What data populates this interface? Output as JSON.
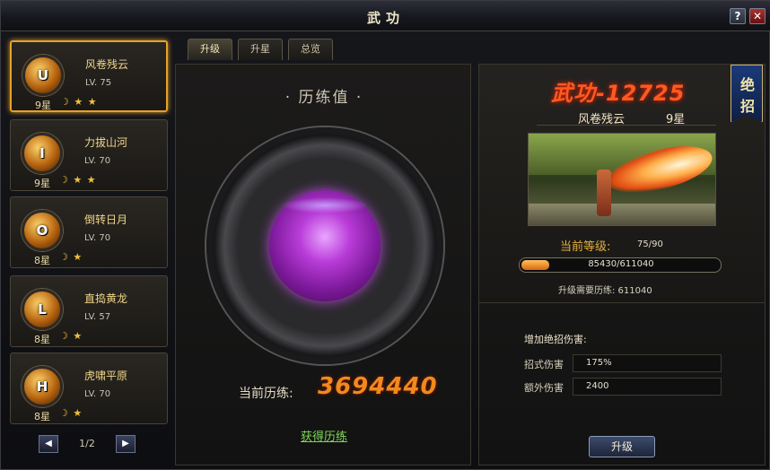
{
  "window": {
    "title": "武功",
    "help_icon": "?",
    "close_icon": "✕"
  },
  "tabs": [
    {
      "label": "升级",
      "active": true
    },
    {
      "label": "升星",
      "active": false
    },
    {
      "label": "总览",
      "active": false
    }
  ],
  "skills": [
    {
      "key": "U",
      "name": "风卷残云",
      "level": "LV. 75",
      "stars": "9星",
      "moons": "☽ ★ ★"
    },
    {
      "key": "I",
      "name": "力拔山河",
      "level": "LV. 70",
      "stars": "9星",
      "moons": "☽ ★ ★"
    },
    {
      "key": "O",
      "name": "倒转日月",
      "level": "LV. 70",
      "stars": "8星",
      "moons": "☽ ★"
    },
    {
      "key": "L",
      "name": "直捣黄龙",
      "level": "LV. 57",
      "stars": "8星",
      "moons": "☽ ★"
    },
    {
      "key": "H",
      "name": "虎啸平原",
      "level": "LV. 70",
      "stars": "8星",
      "moons": "☽ ★"
    }
  ],
  "pager": {
    "prev": "◀",
    "next": "▶",
    "page": "1/2"
  },
  "training": {
    "title": "· 历练值 ·",
    "current_label": "当前历练:",
    "current_value": "3694440",
    "get_link": "获得历练"
  },
  "detail": {
    "power": "武功-12725",
    "badge": [
      "绝",
      "招"
    ],
    "skill_name": "风卷残云",
    "skill_stars": "9星",
    "level_label": "当前等级:",
    "level_value": "75/90",
    "exp_text": "85430/611040",
    "exp_fraction": 0.14,
    "need_label": "升级需要历练: 611040",
    "bonus_title": "增加绝招伤害:",
    "stats": [
      {
        "label": "招式伤害",
        "value": "175%"
      },
      {
        "label": "额外伤害",
        "value": "2400"
      }
    ],
    "upgrade_button": "升级"
  },
  "colors": {
    "accent": "#e6a12a",
    "power": "#ff5a1e",
    "training_value": "#f08a1e",
    "link": "#7ed957",
    "orb": "#b93cd8"
  }
}
